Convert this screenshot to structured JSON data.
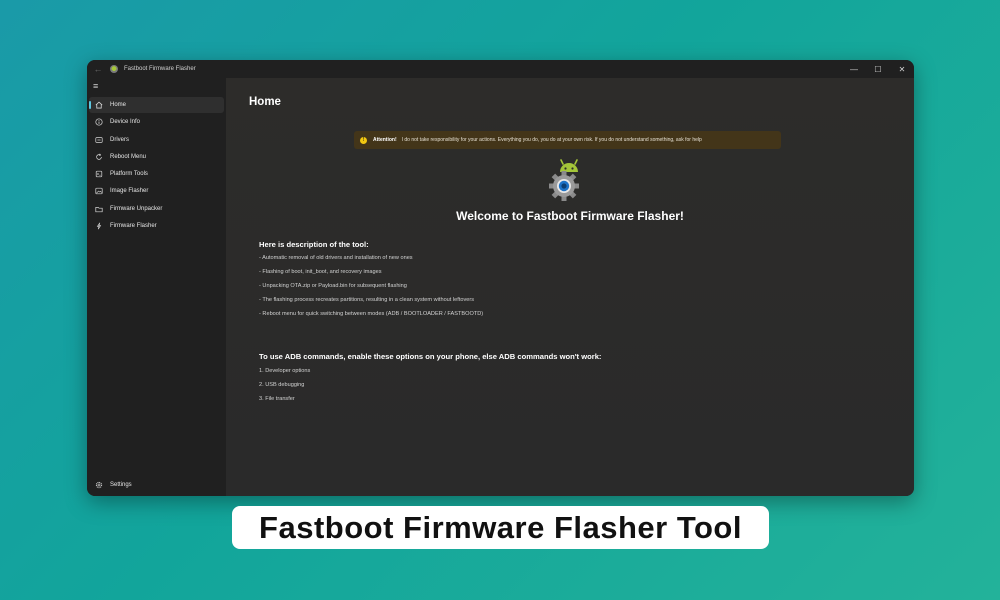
{
  "window": {
    "title": "Fastboot Firmware Flasher",
    "controls": [
      "—",
      "☐",
      "✕"
    ]
  },
  "sidebar": {
    "items": [
      {
        "label": "Home",
        "icon": "home-icon",
        "active": true
      },
      {
        "label": "Device Info",
        "icon": "info-icon"
      },
      {
        "label": "Drivers",
        "icon": "drivers-icon"
      },
      {
        "label": "Reboot Menu",
        "icon": "reboot-icon"
      },
      {
        "label": "Platform Tools",
        "icon": "tools-icon"
      },
      {
        "label": "Image Flasher",
        "icon": "image-icon"
      },
      {
        "label": "Firmware Unpacker",
        "icon": "unpacker-icon"
      },
      {
        "label": "Firmware Flasher",
        "icon": "flash-icon"
      }
    ],
    "settings_label": "Settings"
  },
  "main": {
    "title": "Home",
    "banner": {
      "title": "Attention!",
      "message": "I do not take responsibility for your actions. Everything you do, you do at your own risk. If you do not understand something, ask for help"
    },
    "welcome": "Welcome to Fastboot Firmware Flasher!",
    "description": {
      "heading": "Here is description of the tool:",
      "lines": [
        "- Automatic removal of old drivers and installation of new ones",
        "- Flashing of boot, init_boot, and recovery images",
        "- Unpacking OTA.zip or Payload.bin for subsequent flashing",
        "- The flashing process recreates partitions, resulting in a clean system without leftovers",
        "- Reboot menu for quick switching between modes (ADB / BOOTLOADER / FASTBOOTD)"
      ]
    },
    "adb": {
      "heading": "To use ADB commands, enable these options on your phone, else ADB commands won't work:",
      "lines": [
        "1. Developer options",
        "2. USB debugging",
        "3. File transfer"
      ]
    }
  },
  "caption": "Fastboot Firmware Flasher Tool",
  "colors": {
    "accent": "#5ec7e0",
    "warning": "#f2c811",
    "android_green": "#a4c639",
    "background_teal": "#12a59b"
  }
}
